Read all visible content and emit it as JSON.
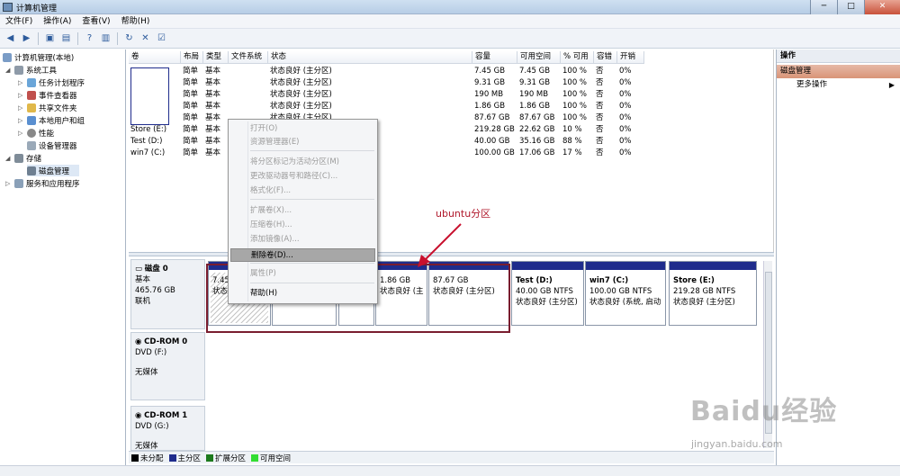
{
  "window": {
    "title": "计算机管理"
  },
  "menu": [
    "文件(F)",
    "操作(A)",
    "查看(V)",
    "帮助(H)"
  ],
  "tree": {
    "root": "计算机管理(本地)",
    "system_tools": "系统工具",
    "task_scheduler": "任务计划程序",
    "event_viewer": "事件查看器",
    "shared_folders": "共享文件夹",
    "local_users": "本地用户和组",
    "performance": "性能",
    "device_manager": "设备管理器",
    "storage": "存储",
    "disk_management": "磁盘管理",
    "services_apps": "服务和应用程序"
  },
  "volume_table": {
    "headers": [
      "卷",
      "布局",
      "类型",
      "文件系统",
      "状态",
      "容量",
      "可用空间",
      "% 可用",
      "容错",
      "开销"
    ],
    "rows": [
      [
        "",
        "简单",
        "基本",
        "",
        "状态良好 (主分区)",
        "7.45 GB",
        "7.45 GB",
        "100 %",
        "否",
        "0%"
      ],
      [
        "",
        "简单",
        "基本",
        "",
        "状态良好 (主分区)",
        "9.31 GB",
        "9.31 GB",
        "100 %",
        "否",
        "0%"
      ],
      [
        "",
        "简单",
        "基本",
        "",
        "状态良好 (主分区)",
        "190 MB",
        "190 MB",
        "100 %",
        "否",
        "0%"
      ],
      [
        "",
        "简单",
        "基本",
        "",
        "状态良好 (主分区)",
        "1.86 GB",
        "1.86 GB",
        "100 %",
        "否",
        "0%"
      ],
      [
        "",
        "简单",
        "基本",
        "",
        "状态良好 (主分区)",
        "87.67 GB",
        "87.67 GB",
        "100 %",
        "否",
        "0%"
      ],
      [
        "Store (E:)",
        "简单",
        "基本",
        "",
        "",
        "219.28 GB",
        "22.62 GB",
        "10 %",
        "否",
        "0%"
      ],
      [
        "Test (D:)",
        "简单",
        "基本",
        "",
        "",
        "40.00 GB",
        "35.16 GB",
        "88 %",
        "否",
        "0%"
      ],
      [
        "win7 (C:)",
        "简单",
        "基本",
        "",
        "活动, 故障转储, 主分区)",
        "100.00 GB",
        "17.06 GB",
        "17 %",
        "否",
        "0%"
      ]
    ]
  },
  "context_menu": [
    {
      "label": "打开(O)",
      "enabled": false
    },
    {
      "label": "资源管理器(E)",
      "enabled": false
    },
    {
      "label": "将分区标记为活动分区(M)",
      "enabled": false
    },
    {
      "label": "更改驱动器号和路径(C)...",
      "enabled": false
    },
    {
      "label": "格式化(F)...",
      "enabled": false
    },
    {
      "label": "扩展卷(X)...",
      "enabled": false
    },
    {
      "label": "压缩卷(H)...",
      "enabled": false
    },
    {
      "label": "添加镜像(A)...",
      "enabled": false
    },
    {
      "label": "删除卷(D)...",
      "enabled": true,
      "highlighted": true
    },
    {
      "label": "属性(P)",
      "enabled": false
    },
    {
      "label": "帮助(H)",
      "enabled": true
    }
  ],
  "annotation": "ubuntu分区",
  "disks": [
    {
      "name": "磁盘 0",
      "type": "基本",
      "size": "465.76 GB",
      "status": "联机"
    },
    {
      "name": "CD-ROM 0",
      "type": "DVD (F:)",
      "media": "无媒体"
    },
    {
      "name": "CD-ROM 1",
      "type": "DVD (G:)",
      "media": "无媒体"
    }
  ],
  "partitions": [
    {
      "title": "",
      "size": "7.45",
      "status": "状态良好 (主分"
    },
    {
      "title": "",
      "size": "",
      "status": "状态良好 (主分"
    },
    {
      "title": "",
      "size": "",
      "status": ""
    },
    {
      "title": "",
      "size": "1.86 GB",
      "status": "状态良好 (主"
    },
    {
      "title": "",
      "size": "87.67 GB",
      "status": "状态良好 (主分区)"
    },
    {
      "title": "Test  (D:)",
      "size": "40.00 GB NTFS",
      "status": "状态良好 (主分区)"
    },
    {
      "title": "win7  (C:)",
      "size": "100.00 GB NTFS",
      "status": "状态良好 (系统, 启动"
    },
    {
      "title": "Store  (E:)",
      "size": "219.28 GB NTFS",
      "status": "状态良好 (主分区)"
    }
  ],
  "legend": [
    {
      "label": "未分配",
      "color": "#000000"
    },
    {
      "label": "主分区",
      "color": "#1f2c8c"
    },
    {
      "label": "扩展分区",
      "color": "#1d7a1d"
    },
    {
      "label": "可用空间",
      "color": "#33dd33"
    }
  ],
  "actions": {
    "title": "操作",
    "section": "磁盘管理",
    "more": "更多操作"
  },
  "watermark": {
    "logo": "Baidu经验",
    "url": "jingyan.baidu.com"
  },
  "colors": {
    "accent": "#1f2c8c",
    "annotation": "#b0182b",
    "box": "#7a1d2f"
  }
}
